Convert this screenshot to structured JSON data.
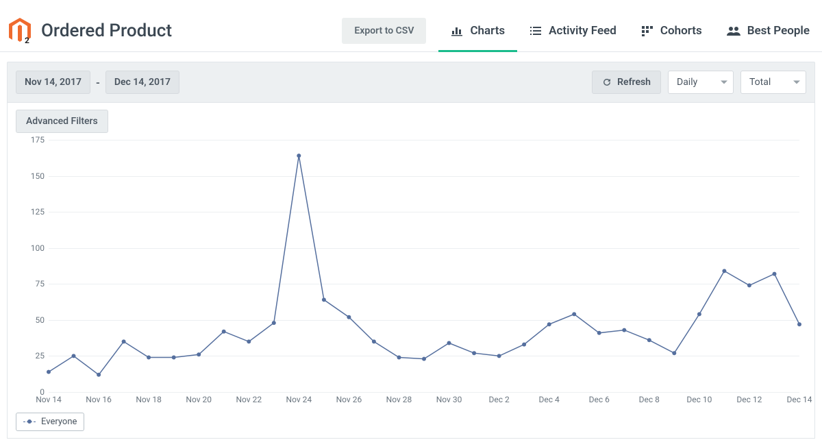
{
  "header": {
    "page_title": "Ordered Product",
    "export_label": "Export to CSV",
    "tabs": [
      {
        "key": "charts",
        "label": "Charts",
        "icon": "bar-chart-icon",
        "active": true
      },
      {
        "key": "activity",
        "label": "Activity Feed",
        "icon": "list-icon",
        "active": false
      },
      {
        "key": "cohorts",
        "label": "Cohorts",
        "icon": "grid-icon",
        "active": false
      },
      {
        "key": "best_people",
        "label": "Best People",
        "icon": "people-icon",
        "active": false
      }
    ]
  },
  "toolbar": {
    "date_from": "Nov 14, 2017",
    "date_sep": "-",
    "date_to": "Dec 14, 2017",
    "refresh_label": "Refresh",
    "granularity_value": "Daily",
    "metric_value": "Total",
    "advanced_filters_label": "Advanced Filters"
  },
  "legend": {
    "series_label": "Everyone"
  },
  "chart_data": {
    "type": "line",
    "title": "",
    "xlabel": "",
    "ylabel": "",
    "series": [
      {
        "name": "Everyone",
        "x": [
          "Nov 14",
          "Nov 15",
          "Nov 16",
          "Nov 17",
          "Nov 18",
          "Nov 19",
          "Nov 20",
          "Nov 21",
          "Nov 22",
          "Nov 23",
          "Nov 24",
          "Nov 25",
          "Nov 26",
          "Nov 27",
          "Nov 28",
          "Nov 29",
          "Nov 30",
          "Dec 1",
          "Dec 2",
          "Dec 3",
          "Dec 4",
          "Dec 5",
          "Dec 6",
          "Dec 7",
          "Dec 8",
          "Dec 9",
          "Dec 10",
          "Dec 11",
          "Dec 12",
          "Dec 13",
          "Dec 14"
        ],
        "values": [
          14,
          25,
          12,
          35,
          24,
          24,
          26,
          42,
          35,
          48,
          164,
          64,
          52,
          35,
          24,
          23,
          34,
          27,
          25,
          33,
          47,
          54,
          41,
          43,
          36,
          27,
          54,
          84,
          74,
          82,
          47
        ]
      }
    ],
    "yticks": [
      0,
      25,
      50,
      75,
      100,
      125,
      150,
      175
    ],
    "ylim": [
      0,
      175
    ],
    "xticks": [
      "Nov 14",
      "Nov 16",
      "Nov 18",
      "Nov 20",
      "Nov 22",
      "Nov 24",
      "Nov 26",
      "Nov 28",
      "Nov 30",
      "Dec 2",
      "Dec 4",
      "Dec 6",
      "Dec 8",
      "Dec 10",
      "Dec 12",
      "Dec 14"
    ]
  }
}
